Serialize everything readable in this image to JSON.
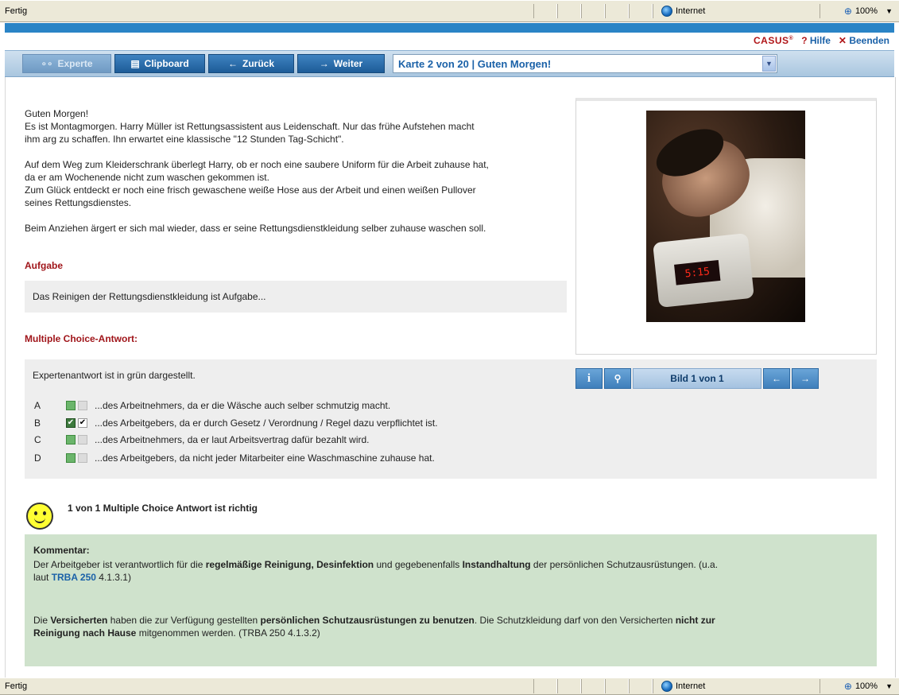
{
  "status_top": {
    "text": "Fertig",
    "zone": "Internet",
    "zoom": "100%"
  },
  "status_bottom": {
    "text": "Fertig",
    "zone": "Internet",
    "zoom": "100%"
  },
  "header": {
    "logo": "CASUS",
    "logo_reg": "®",
    "help_label": "Hilfe",
    "exit_label": "Beenden"
  },
  "toolbar": {
    "expert_label": "Experte",
    "clipboard_label": "Clipboard",
    "back_label": "Zurück",
    "next_label": "Weiter",
    "card_select_value": "Karte 2 von 20 | Guten Morgen!"
  },
  "story": {
    "greeting": "Guten Morgen!",
    "line1": "Es ist Montagmorgen. Harry Müller ist Rettungsassistent aus Leidenschaft. Nur das frühe Aufstehen macht",
    "line2": "ihm arg zu schaffen. Ihn erwartet eine klassische \"12 Stunden Tag-Schicht\".",
    "line3": "Auf dem Weg zum Kleiderschrank überlegt Harry, ob er noch eine saubere Uniform für die Arbeit zuhause hat,",
    "line4": "da er am Wochenende nicht zum waschen gekommen ist.",
    "line5": "Zum Glück entdeckt er noch eine frisch gewaschene weiße Hose aus der Arbeit und einen weißen Pullover",
    "line6": "seines Rettungsdienstes.",
    "line7": "Beim Anziehen ärgert er sich mal wieder, dass er seine Rettungsdienstkleidung selber zuhause waschen soll."
  },
  "task": {
    "title": "Aufgabe",
    "text": "Das Reinigen der Rettungsdienstkleidung ist Aufgabe..."
  },
  "mc": {
    "title": "Multiple Choice-Antwort:",
    "intro": "Expertenantwort ist in grün dargestellt.",
    "options": [
      {
        "letter": "A",
        "text": "...des Arbeitnehmers, da er die Wäsche auch selber schmutzig macht."
      },
      {
        "letter": "B",
        "text": "...des Arbeitgebers, da er durch Gesetz / Verordnung / Regel dazu verpflichtet ist."
      },
      {
        "letter": "C",
        "text": "...des Arbeitnehmers, da er laut Arbeitsvertrag dafür bezahlt wird."
      },
      {
        "letter": "D",
        "text": "...des Arbeitgebers, da nicht jeder Mitarbeiter eine Waschmaschine zuhause hat."
      }
    ],
    "check_mark": "✔"
  },
  "image": {
    "clock_time": "5:15",
    "counter_prefix": "Bild",
    "counter_current": "1",
    "counter_suffix": "von 1",
    "info_glyph": "i"
  },
  "result": {
    "text": "1 von 1 Multiple Choice Antwort ist richtig"
  },
  "comment": {
    "title": "Kommentar:",
    "p1_a": "Der Arbeitgeber ist verantwortlich für die ",
    "p1_b": "regelmäßige Reinigung, Desinfektion",
    "p1_c": " und gegebenenfalls ",
    "p1_d": "Instandhaltung",
    "p1_e": " der persönlichen Schutzausrüstungen. (u.a.",
    "p1_f": "laut ",
    "p1_link": "TRBA 250",
    "p1_g": " 4.1.3.1)",
    "p2_a": "Die ",
    "p2_b": "Versicherten",
    "p2_c": " haben die zur Verfügung gestellten ",
    "p2_d": "persönlichen Schutzausrüstungen zu benutzen",
    "p2_e": ". Die Schutzkleidung darf von den Versicherten ",
    "p2_f": "nicht zur",
    "p2_g": "Reinigung nach Hause",
    "p2_h": " mitgenommen werden. (TRBA 250 4.1.3.2)"
  }
}
